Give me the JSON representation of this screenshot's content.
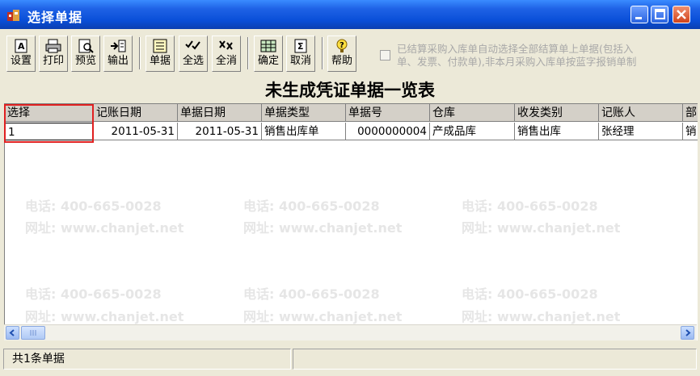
{
  "window": {
    "title": "选择单据"
  },
  "toolbar": {
    "buttons": [
      {
        "label": "设置",
        "icon": "settings-doc-icon"
      },
      {
        "label": "打印",
        "icon": "printer-icon"
      },
      {
        "label": "预览",
        "icon": "preview-icon"
      },
      {
        "label": "输出",
        "icon": "export-icon"
      },
      {
        "label": "单据",
        "icon": "document-list-icon"
      },
      {
        "label": "全选",
        "icon": "select-all-icon"
      },
      {
        "label": "全消",
        "icon": "deselect-all-icon"
      },
      {
        "label": "确定",
        "icon": "confirm-icon"
      },
      {
        "label": "取消",
        "icon": "cancel-icon"
      },
      {
        "label": "帮助",
        "icon": "help-icon"
      }
    ],
    "auto_select_label_line1": "已结算采购入库单自动选择全部结算单上单据(包括入",
    "auto_select_label_line2": "单、发票、付款单),非本月采购入库单按蓝字报销单制",
    "auto_select_checked": false
  },
  "report": {
    "title": "未生成凭证单据一览表"
  },
  "grid": {
    "columns": [
      "选择",
      "记账日期",
      "单据日期",
      "单据类型",
      "单据号",
      "仓库",
      "收发类别",
      "记账人",
      "部"
    ],
    "rows": [
      [
        "1",
        "2011-05-31",
        "2011-05-31",
        "销售出库单",
        "0000000004",
        "产成品库",
        "销售出库",
        "张经理",
        "销"
      ]
    ]
  },
  "status": {
    "count_text": "共1条单据"
  },
  "watermark": {
    "phone": "电话: 400-665-0028",
    "site": "网址: www.chanjet.net"
  },
  "colors": {
    "title_bar": "#0A4FD8",
    "highlight": "#E02020",
    "window_bg": "#ECE9D8"
  }
}
